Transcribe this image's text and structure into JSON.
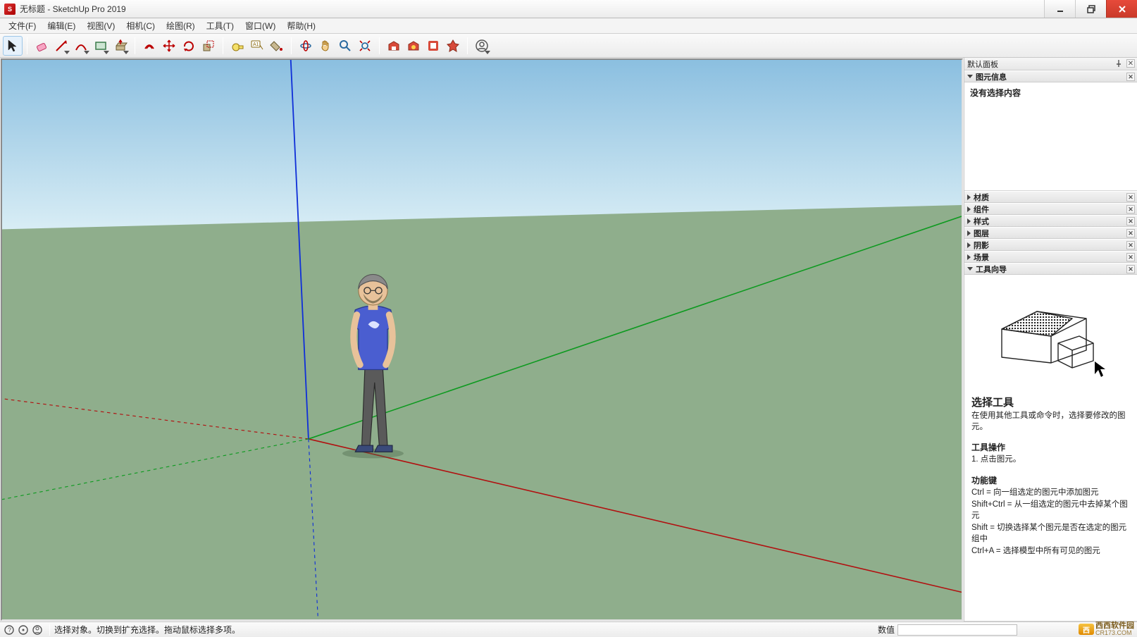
{
  "window": {
    "title": "无标题 - SketchUp Pro 2019"
  },
  "menu": {
    "items": [
      "文件(F)",
      "编辑(E)",
      "视图(V)",
      "相机(C)",
      "绘图(R)",
      "工具(T)",
      "窗口(W)",
      "帮助(H)"
    ]
  },
  "toolbar": {
    "groups": [
      {
        "tools": [
          {
            "id": "select",
            "name": "select-tool",
            "active": true
          }
        ]
      },
      {
        "tools": [
          {
            "id": "eraser",
            "name": "eraser-tool"
          },
          {
            "id": "line",
            "name": "line-tool",
            "dropdown": true
          },
          {
            "id": "arc",
            "name": "arc-tool",
            "dropdown": true
          },
          {
            "id": "rectangle",
            "name": "shape-tool",
            "dropdown": true
          },
          {
            "id": "pushpull",
            "name": "pushpull-tool",
            "dropdown": true
          }
        ]
      },
      {
        "tools": [
          {
            "id": "offset",
            "name": "offset-tool"
          },
          {
            "id": "move",
            "name": "move-tool"
          },
          {
            "id": "rotate",
            "name": "rotate-tool"
          },
          {
            "id": "scale",
            "name": "scale-tool"
          }
        ]
      },
      {
        "tools": [
          {
            "id": "tape",
            "name": "tape-measure-tool"
          },
          {
            "id": "text",
            "name": "text-tool"
          },
          {
            "id": "paint",
            "name": "paint-bucket-tool"
          }
        ]
      },
      {
        "tools": [
          {
            "id": "orbit",
            "name": "orbit-tool"
          },
          {
            "id": "pan",
            "name": "pan-tool"
          },
          {
            "id": "zoom",
            "name": "zoom-tool"
          },
          {
            "id": "zoomext",
            "name": "zoom-extents-tool"
          }
        ]
      },
      {
        "tools": [
          {
            "id": "warehouse",
            "name": "3d-warehouse-tool"
          },
          {
            "id": "extwarehouse",
            "name": "extension-warehouse-tool"
          },
          {
            "id": "layout",
            "name": "send-to-layout-tool"
          },
          {
            "id": "extmgr",
            "name": "extension-manager-tool"
          }
        ]
      },
      {
        "tools": [
          {
            "id": "signin",
            "name": "sign-in-tool",
            "dropdown": true
          }
        ]
      }
    ]
  },
  "sidepanel": {
    "tray_title": "默认面板",
    "entity_info": {
      "header": "图元信息",
      "message": "没有选择内容"
    },
    "collapsed_panels": [
      "材质",
      "组件",
      "样式",
      "图层",
      "阴影",
      "场景"
    ],
    "instructor": {
      "header": "工具向导",
      "tool_title": "选择工具",
      "tool_desc": "在使用其他工具或命令时，选择要修改的图元。",
      "op_header": "工具操作",
      "op_1": "1. 点击图元。",
      "keys_header": "功能键",
      "key_ctrl": "Ctrl = 向一组选定的图元中添加图元",
      "key_shift_ctrl": "Shift+Ctrl = 从一组选定的图元中去掉某个图元",
      "key_shift": "Shift = 切换选择某个图元是否在选定的图元组中",
      "key_ctrl_a": "Ctrl+A = 选择模型中所有可见的图元"
    }
  },
  "statusbar": {
    "hint": "选择对象。切换到扩充选择。拖动鼠标选择多项。",
    "measure_label": "数值",
    "measure_value": "",
    "watermark_main": "西西软件园",
    "watermark_sub": "CR173.COM"
  }
}
